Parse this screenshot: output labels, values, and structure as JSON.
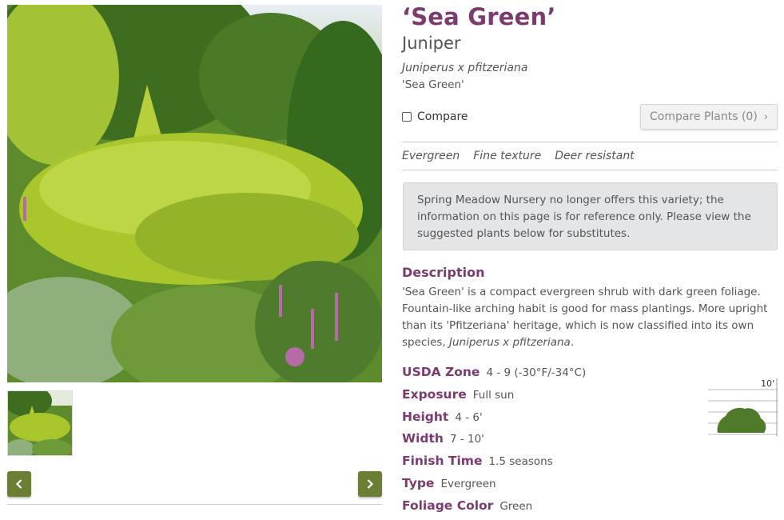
{
  "plant": {
    "name": "‘Sea Green’",
    "common_name": "Juniper",
    "botanical_name": "Juniperus x pfitzeriana",
    "cultivar": "'Sea Green'"
  },
  "compare": {
    "checkbox_label": "Compare",
    "button_label": "Compare Plants (0)",
    "button_chevron": "›"
  },
  "tags": [
    "Evergreen",
    "Fine texture",
    "Deer resistant"
  ],
  "notice": "Spring Meadow Nursery no longer offers this variety; the information on this page is for reference only. Please view the suggested plants below for substitutes.",
  "description": {
    "heading": "Description",
    "text_part1": "'Sea Green' is a compact evergreen shrub with dark green foliage. Fountain-like arching habit is good for mass plantings. More upright than its 'Pfitzeriana' heritage, which is now classified into its own species, ",
    "text_italic": "Juniperus x pfitzeriana",
    "text_end": "."
  },
  "attributes": [
    {
      "label": "USDA Zone",
      "value": "4 - 9 (-30°F/-34°C)"
    },
    {
      "label": "Exposure",
      "value": "Full sun"
    },
    {
      "label": "Height",
      "value": "4 - 6'"
    },
    {
      "label": "Width",
      "value": "7 - 10'"
    },
    {
      "label": "Finish Time",
      "value": "1.5 seasons"
    },
    {
      "label": "Type",
      "value": "Evergreen"
    },
    {
      "label": "Foliage Color",
      "value": "Green"
    }
  ],
  "size_chart": {
    "scale_label": "10'",
    "color": "#4f7a2a"
  },
  "colors": {
    "accent": "#7b3b6f",
    "nav_button": "#6b7f34"
  },
  "icons": {
    "prev": "chevron-left-icon",
    "next": "chevron-right-icon"
  }
}
